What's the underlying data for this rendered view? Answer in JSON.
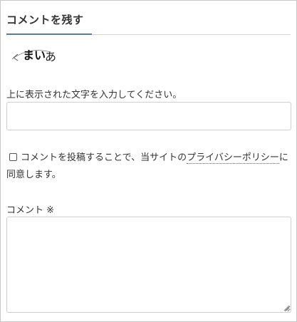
{
  "section": {
    "title": "コメントを残す"
  },
  "captcha": {
    "image_text": "まいあ",
    "instruction": "上に表示された文字を入力してください。",
    "input_value": ""
  },
  "consent": {
    "checked": false,
    "text_before": "コメントを投稿することで、当サイトの",
    "link_text": "プライバシーポリシー",
    "text_after": "に同意します。"
  },
  "comment": {
    "label": "コメント ※",
    "value": ""
  },
  "colors": {
    "accent": "#5b7b99",
    "border": "#d0d0d0",
    "text": "#333333"
  }
}
